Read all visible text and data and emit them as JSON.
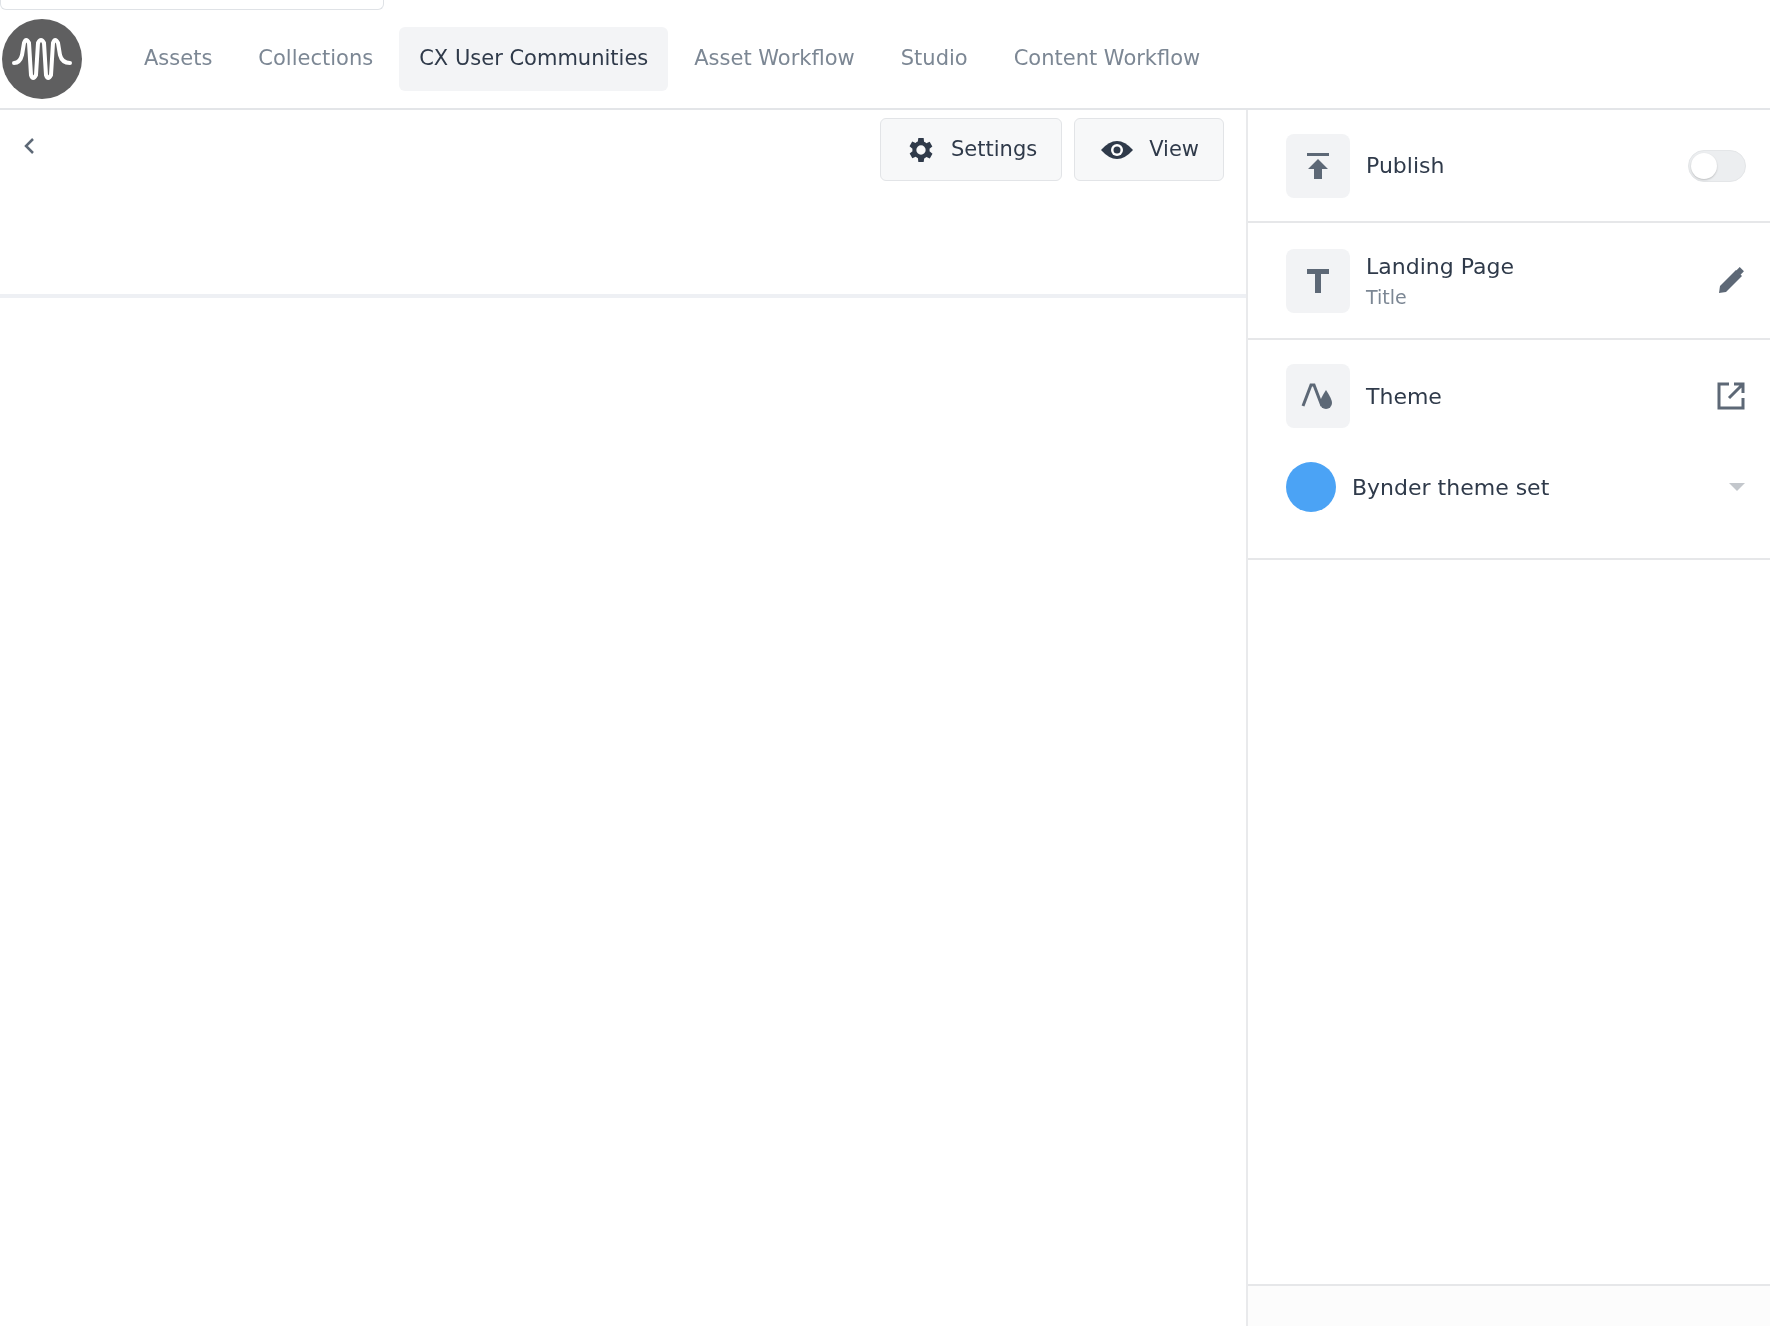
{
  "nav": {
    "tabs": [
      {
        "label": "Assets",
        "selected": false
      },
      {
        "label": "Collections",
        "selected": false
      },
      {
        "label": "CX User Communities",
        "selected": true
      },
      {
        "label": "Asset Workflow",
        "selected": false
      },
      {
        "label": "Studio",
        "selected": false
      },
      {
        "label": "Content Workflow",
        "selected": false
      }
    ]
  },
  "toolbar": {
    "buttons": [
      {
        "kind": "settings",
        "label": "Settings"
      },
      {
        "kind": "view",
        "label": "View"
      }
    ]
  },
  "panel": {
    "publish": {
      "label": "Publish",
      "on": false
    },
    "title_field": {
      "label": "Landing Page",
      "sublabel": "Title"
    },
    "theme": {
      "label": "Theme",
      "theme_set": "Bynder theme set"
    }
  }
}
